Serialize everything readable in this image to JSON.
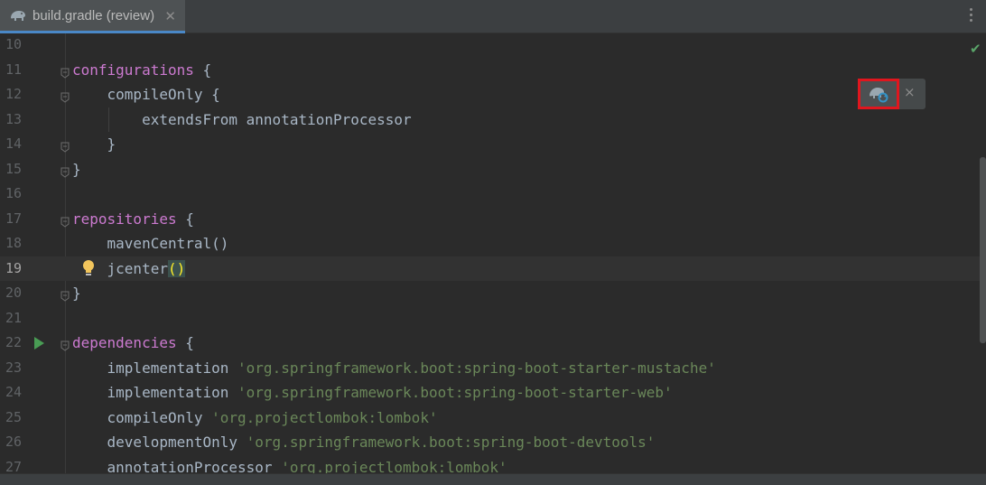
{
  "tab": {
    "label": "build.gradle (review)",
    "close": "✕"
  },
  "popup": {
    "close": "×"
  },
  "colors": {
    "keyword": "#cc7ad0",
    "string": "#6a8759",
    "plain": "#a9b7c6",
    "highlight": "#e0161e"
  },
  "lines": [
    {
      "num": "10",
      "parts": []
    },
    {
      "num": "11",
      "parts": [
        {
          "t": "configurations",
          "c": "kw"
        },
        {
          "t": " {",
          "c": ""
        }
      ]
    },
    {
      "num": "12",
      "parts": [
        {
          "t": "    compileOnly {",
          "c": ""
        }
      ]
    },
    {
      "num": "13",
      "parts": [
        {
          "t": "        extendsFrom annotationProcessor",
          "c": ""
        }
      ]
    },
    {
      "num": "14",
      "parts": [
        {
          "t": "    }",
          "c": ""
        }
      ]
    },
    {
      "num": "15",
      "parts": [
        {
          "t": "}",
          "c": ""
        }
      ]
    },
    {
      "num": "16",
      "parts": []
    },
    {
      "num": "17",
      "parts": [
        {
          "t": "repositories",
          "c": "kw"
        },
        {
          "t": " {",
          "c": ""
        }
      ]
    },
    {
      "num": "18",
      "parts": [
        {
          "t": "    mavenCentral()",
          "c": ""
        }
      ]
    },
    {
      "num": "19",
      "parts": [
        {
          "t": "    jcenter",
          "c": ""
        },
        {
          "t": "()",
          "c": "paren-hl"
        }
      ]
    },
    {
      "num": "20",
      "parts": [
        {
          "t": "}",
          "c": ""
        }
      ]
    },
    {
      "num": "21",
      "parts": []
    },
    {
      "num": "22",
      "parts": [
        {
          "t": "dependencies",
          "c": "kw"
        },
        {
          "t": " {",
          "c": ""
        }
      ]
    },
    {
      "num": "23",
      "parts": [
        {
          "t": "    implementation ",
          "c": ""
        },
        {
          "t": "'org.springframework.boot:spring-boot-starter-mustache'",
          "c": "str"
        }
      ]
    },
    {
      "num": "24",
      "parts": [
        {
          "t": "    implementation ",
          "c": ""
        },
        {
          "t": "'org.springframework.boot:spring-boot-starter-web'",
          "c": "str"
        }
      ]
    },
    {
      "num": "25",
      "parts": [
        {
          "t": "    compileOnly ",
          "c": ""
        },
        {
          "t": "'org.projectlombok:lombok'",
          "c": "str"
        }
      ]
    },
    {
      "num": "26",
      "parts": [
        {
          "t": "    developmentOnly ",
          "c": ""
        },
        {
          "t": "'org.springframework.boot:spring-boot-devtools'",
          "c": "str"
        }
      ]
    },
    {
      "num": "27",
      "parts": [
        {
          "t": "    annotationProcessor ",
          "c": ""
        },
        {
          "t": "'org.projectlombok:lombok'",
          "c": "str"
        }
      ]
    }
  ],
  "current_line": "19",
  "fold_lines": [
    "11",
    "12",
    "14",
    "15",
    "17",
    "20",
    "22"
  ],
  "run_line": "22",
  "bulb_line": "19"
}
